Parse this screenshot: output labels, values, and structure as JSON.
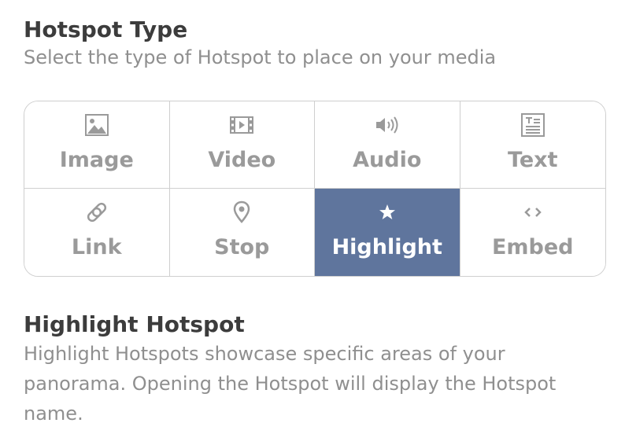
{
  "section": {
    "title": "Hotspot Type",
    "subtitle": "Select the type of Hotspot to place on your media"
  },
  "types": [
    {
      "label": "Image",
      "icon": "image-icon",
      "selected": false
    },
    {
      "label": "Video",
      "icon": "video-icon",
      "selected": false
    },
    {
      "label": "Audio",
      "icon": "audio-icon",
      "selected": false
    },
    {
      "label": "Text",
      "icon": "text-icon",
      "selected": false
    },
    {
      "label": "Link",
      "icon": "link-icon",
      "selected": false
    },
    {
      "label": "Stop",
      "icon": "map-pin-icon",
      "selected": false
    },
    {
      "label": "Highlight",
      "icon": "star-icon",
      "selected": true
    },
    {
      "label": "Embed",
      "icon": "code-icon",
      "selected": false
    }
  ],
  "description": {
    "title": "Highlight Hotspot",
    "text": "Highlight Hotspots showcase specific areas of your panorama. Opening the Hotspot will display the Hotspot name."
  },
  "colors": {
    "selected_bg": "#5f759d",
    "tile_text": "#9a9a9a",
    "border": "#cfcfcf"
  }
}
